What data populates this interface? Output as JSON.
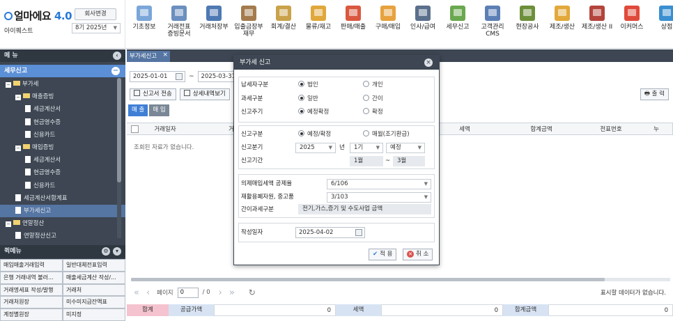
{
  "brand": {
    "logo_main": "얼마에요",
    "logo_ver": "4.0",
    "company": "아이퀘스트",
    "change_company": "회사변경",
    "fiscal_year": "8기 2025년"
  },
  "toolbar": [
    {
      "label": "기초정보",
      "color": "#7aa6d9"
    },
    {
      "label": "거래전표\n증빙문서",
      "color": "#6b8fbf"
    },
    {
      "label": "거래처장부",
      "color": "#4e79b3"
    },
    {
      "label": "입출금장부\n재무",
      "color": "#a47b4d"
    },
    {
      "label": "회계/결산",
      "color": "#c9a24a"
    },
    {
      "label": "물류/재고",
      "color": "#e0a73b"
    },
    {
      "label": "판매/매출",
      "color": "#d9583f"
    },
    {
      "label": "구매/매입",
      "color": "#e7a23e"
    },
    {
      "label": "인사/급여",
      "color": "#5a6f8c"
    },
    {
      "label": "세무신고",
      "color": "#6aa84f"
    },
    {
      "label": "고객관리\nCMS",
      "color": "#5b7fb5"
    },
    {
      "label": "현장공사",
      "color": "#6d8f3a"
    },
    {
      "label": "제조/생산",
      "color": "#e2a83a"
    },
    {
      "label": "제조/생산 II",
      "color": "#b3443c"
    },
    {
      "label": "이커머스",
      "color": "#e04a3a"
    },
    {
      "label": "상점",
      "color": "#3a8fd0"
    }
  ],
  "sidebar": {
    "menu_title": "메 뉴",
    "section": "세무신고",
    "tree": [
      {
        "label": "부가세",
        "level": 0,
        "type": "folder"
      },
      {
        "label": "매출증빙",
        "level": 1,
        "type": "folder"
      },
      {
        "label": "세금계산서",
        "level": 2,
        "type": "doc"
      },
      {
        "label": "현금영수증",
        "level": 2,
        "type": "doc"
      },
      {
        "label": "신용카드",
        "level": 2,
        "type": "doc"
      },
      {
        "label": "매입증빙",
        "level": 1,
        "type": "folder"
      },
      {
        "label": "세금계산서",
        "level": 2,
        "type": "doc"
      },
      {
        "label": "현금영수증",
        "level": 2,
        "type": "doc"
      },
      {
        "label": "신용카드",
        "level": 2,
        "type": "doc"
      },
      {
        "label": "세금계산서합계표",
        "level": 1,
        "type": "doc"
      },
      {
        "label": "부가세신고",
        "level": 1,
        "type": "doc",
        "selected": true
      },
      {
        "label": "연말정산",
        "level": 0,
        "type": "folder"
      },
      {
        "label": "연말정산신고",
        "level": 1,
        "type": "doc"
      }
    ],
    "quick_title": "퀵메뉴",
    "quick": [
      [
        "매입매출거래입력",
        "일반대체전표입력"
      ],
      [
        "은행 거래내역 불러...",
        "매출세금계산 작성/..."
      ],
      [
        "거래명세표 작성/발행",
        "거래처"
      ],
      [
        "거래처원장",
        "미수미지급잔액표"
      ],
      [
        "계정별원장",
        "미지정"
      ]
    ]
  },
  "main": {
    "tab_label": "부가세신고",
    "tab_close": "×",
    "date_from": "2025-01-01",
    "date_to": "2025-03-31",
    "date_sep": "~",
    "btn_send": "신고서 전송",
    "btn_detail": "상세내역보기",
    "btn_print": "출 력",
    "subtabs": [
      {
        "label": "매 출",
        "color": "#3f7fd6"
      },
      {
        "label": "매 입",
        "color": "#7a8796"
      }
    ],
    "columns": [
      "거래일자",
      "거",
      "세액",
      "합계금액",
      "전표번호",
      "누"
    ],
    "empty_text": "조회된 자료가 없습니다.",
    "pager": {
      "page_label": "페이지",
      "page": "0",
      "total": "/ 0"
    },
    "no_data": "표시할 데이터가 없습니다.",
    "summary": {
      "total_label": "합계",
      "supply_label": "공급가액",
      "supply": "0",
      "tax_label": "세액",
      "tax": "0",
      "sum_label": "합계금액",
      "sum": "0"
    }
  },
  "modal": {
    "title": "부가세 신고",
    "taxpayer_label": "납세자구분",
    "corp": "법인",
    "indiv": "개인",
    "taxtype_label": "과세구분",
    "general": "일반",
    "simple": "간이",
    "cycle_label": "신고주기",
    "preliminary": "예정확정",
    "final": "확정",
    "report_type_label": "신고구분",
    "rt1": "예정/확정",
    "rt2": "매월(조기환급)",
    "period_label": "신고분기",
    "year": "2025",
    "year_unit": "년",
    "quarter": "1기",
    "kind": "예정",
    "range_label": "신고기간",
    "month_from": "1월",
    "month_to": "3월",
    "tilde": "~",
    "deemed_label": "의제매입세액 공제율",
    "deemed": "6/106",
    "recycle_label": "재활용폐자원, 중고품",
    "recycle": "3/103",
    "simple_type_label": "간이과세구분",
    "simple_type": "전기,가스,증기 및 수도사업 금액",
    "date_label": "작성일자",
    "date": "2025-04-02",
    "apply": "적 용",
    "cancel": "취 소"
  }
}
